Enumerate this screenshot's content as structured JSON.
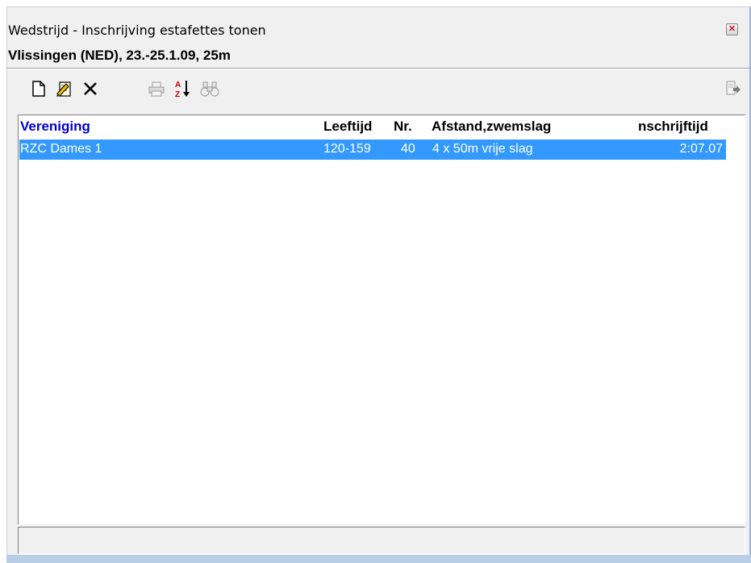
{
  "window": {
    "title": "Wedstrijd - Inschrijving estafettes tonen",
    "close_glyph": "✕"
  },
  "subtitle": "Vlissingen (NED), 23.-25.1.09, 25m",
  "toolbar": [
    {
      "icon": "new-document-icon",
      "enabled": true
    },
    {
      "icon": "edit-document-icon",
      "enabled": true
    },
    {
      "icon": "delete-icon",
      "enabled": true
    },
    {
      "icon": "print-icon",
      "enabled": false
    },
    {
      "icon": "sort-az-icon",
      "enabled": true
    },
    {
      "icon": "find-binoculars-icon",
      "enabled": false
    },
    {
      "icon": "export-icon",
      "enabled": false
    }
  ],
  "table": {
    "columns": [
      "Vereniging",
      "Leeftijd",
      "Nr.",
      "Afstand,zwemslag",
      "nschrijftijd"
    ],
    "rows": [
      {
        "vereniging": "RZC Dames 1",
        "leeftijd": "120-159",
        "nr": "40",
        "afstand": "4 x 50m vrije slag",
        "tijd": "2:07.07",
        "selected": true
      }
    ]
  },
  "colors": {
    "selection": "#3399ff",
    "header_first_column": "#0000cc"
  },
  "statusbar": {
    "text": ""
  }
}
